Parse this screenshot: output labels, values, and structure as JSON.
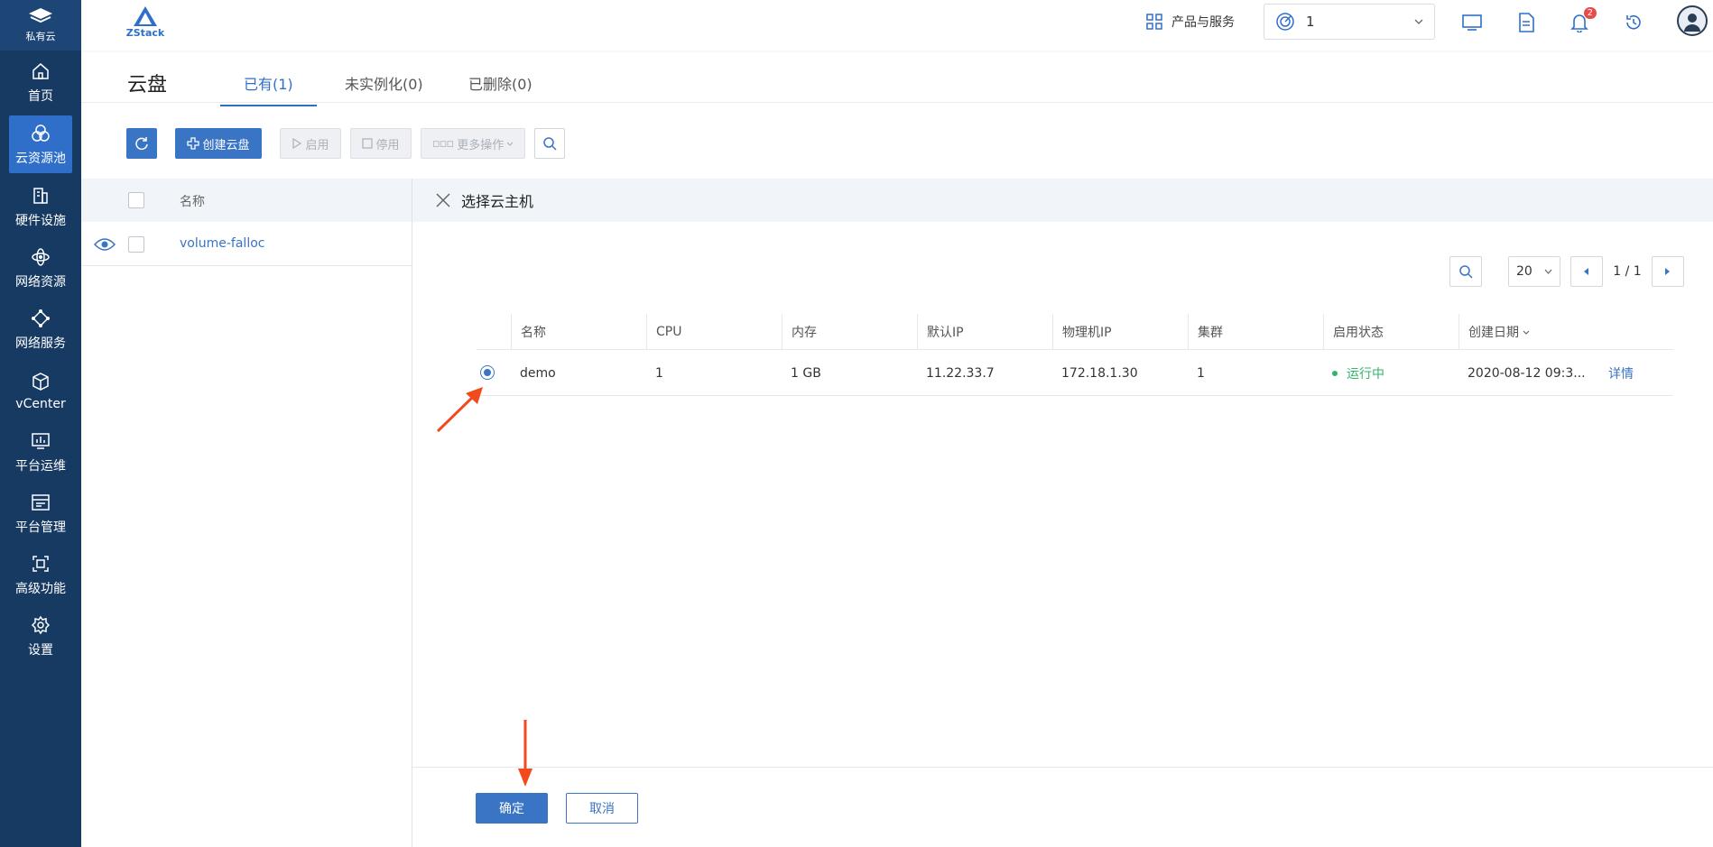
{
  "sidebar": {
    "brand": "私有云",
    "items": [
      {
        "label": "首页",
        "icon": "home-icon"
      },
      {
        "label": "云资源池",
        "icon": "cloud-pool-icon",
        "active": true
      },
      {
        "label": "硬件设施",
        "icon": "hardware-icon"
      },
      {
        "label": "网络资源",
        "icon": "network-resource-icon"
      },
      {
        "label": "网络服务",
        "icon": "network-service-icon"
      },
      {
        "label": "vCenter",
        "icon": "vcenter-cube-icon"
      },
      {
        "label": "平台运维",
        "icon": "monitor-chart-icon"
      },
      {
        "label": "平台管理",
        "icon": "platform-manage-icon"
      },
      {
        "label": "高级功能",
        "icon": "advanced-icon"
      },
      {
        "label": "设置",
        "icon": "gear-icon"
      }
    ]
  },
  "topbar": {
    "logo_text": "ZStack",
    "products_label": "产品与服务",
    "zone_value": "1",
    "notification_count": "2"
  },
  "page": {
    "title": "云盘",
    "tabs": [
      {
        "label": "已有(1)",
        "active": true
      },
      {
        "label": "未实例化(0)"
      },
      {
        "label": "已删除(0)"
      }
    ]
  },
  "toolbar": {
    "create_label": "创建云盘",
    "enable_label": "启用",
    "disable_label": "停用",
    "more_label": "更多操作"
  },
  "volume_list": {
    "header_name": "名称",
    "rows": [
      {
        "name": "volume-falloc"
      }
    ]
  },
  "panel": {
    "title": "选择云主机",
    "page_size": "20",
    "page_info": "1 / 1",
    "columns": [
      "名称",
      "CPU",
      "内存",
      "默认IP",
      "物理机IP",
      "集群",
      "启用状态",
      "创建日期"
    ],
    "rows": [
      {
        "name": "demo",
        "cpu": "1",
        "memory": "1 GB",
        "default_ip": "11.22.33.7",
        "host_ip": "172.18.1.30",
        "cluster": "1",
        "status": "运行中",
        "created": "2020-08-12 09:3...",
        "detail": "详情"
      }
    ],
    "ok_label": "确定",
    "cancel_label": "取消"
  },
  "colors": {
    "sidebar_bg": "#173a63",
    "accent": "#3a74c4",
    "running_green": "#34b36a",
    "annotation_arrow": "#f04a1d"
  }
}
